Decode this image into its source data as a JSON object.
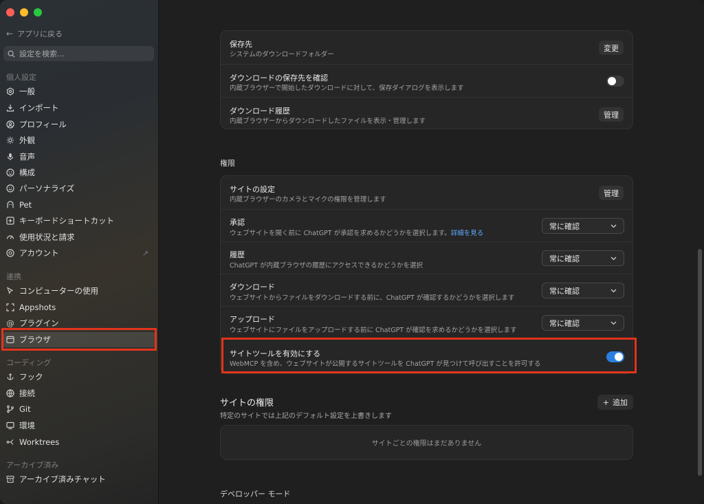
{
  "sidebar": {
    "back_label": "アプリに戻る",
    "search_placeholder": "設定を検索...",
    "sections": {
      "personal": "個人設定",
      "integrations": "連携",
      "coding": "コーディング",
      "archived": "アーカイブ済み"
    },
    "items": {
      "general": "一般",
      "import": "インポート",
      "profile": "プロフィール",
      "appearance": "外観",
      "voice": "音声",
      "composition": "構成",
      "personalize": "パーソナライズ",
      "pet": "Pet",
      "shortcuts": "キーボードショートカット",
      "usage": "使用状況と請求",
      "account": "アカウント",
      "computer_use": "コンピューターの使用",
      "appshots": "Appshots",
      "plugins": "プラグイン",
      "browser": "ブラウザ",
      "hooks": "フック",
      "connections": "接続",
      "git": "Git",
      "environment": "環境",
      "worktrees": "Worktrees",
      "archived_chats": "アーカイブ済みチャット"
    }
  },
  "download": {
    "location_title": "保存先",
    "location_sub": "システムのダウンロードフォルダー",
    "location_btn": "変更",
    "confirm_title": "ダウンロードの保存先を確認",
    "confirm_sub": "内蔵ブラウザーで開始したダウンロードに対して、保存ダイアログを表示します",
    "history_title": "ダウンロード履歴",
    "history_sub": "内蔵ブラウザーからダウンロードしたファイルを表示・管理します",
    "history_btn": "管理"
  },
  "permissions": {
    "heading": "権限",
    "site_settings_title": "サイトの設定",
    "site_settings_sub": "内蔵ブラウザーのカメラとマイクの権限を管理します",
    "site_settings_btn": "管理",
    "approval_title": "承認",
    "approval_sub": "ウェブサイトを開く前に ChatGPT が承認を求めるかどうかを選択します。",
    "approval_link": "詳細を見る",
    "history_title": "履歴",
    "history_sub": "ChatGPT が内蔵ブラウザの履歴にアクセスできるかどうかを選択",
    "download_title": "ダウンロード",
    "download_sub": "ウェブサイトからファイルをダウンロードする前に、ChatGPT が確認するかどうかを選択します",
    "upload_title": "アップロード",
    "upload_sub": "ウェブサイトにファイルをアップロードする前に ChatGPT が確認を求めるかどうかを選択します",
    "select_value": "常に確認",
    "site_tools_title": "サイトツールを有効にする",
    "site_tools_sub": "WebMCP を含め、ウェブサイトが公開するサイトツールを ChatGPT が見つけて呼び出すことを許可する"
  },
  "site_permissions": {
    "heading": "サイトの権限",
    "sub": "特定のサイトでは上記のデフォルト設定を上書きします",
    "add_btn": "追加",
    "empty": "サイトごとの権限はまだありません"
  },
  "developer": {
    "heading": "デベロッパー モード"
  },
  "colors": {
    "accent": "#2b7fe0",
    "highlight": "#e4341c",
    "link": "#5ea9ff"
  }
}
